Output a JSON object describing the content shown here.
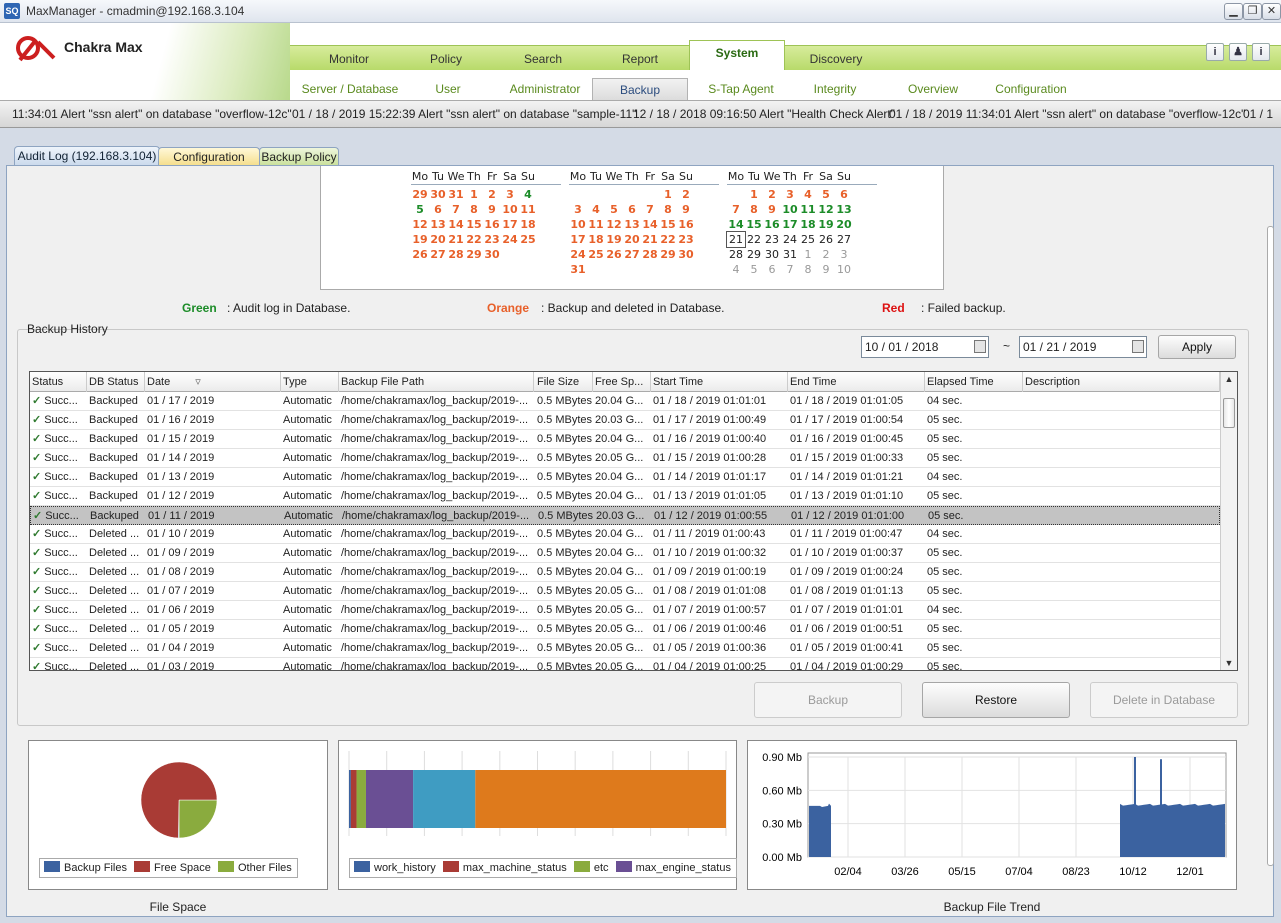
{
  "window": {
    "title": "MaxManager - cmadmin@192.168.3.104"
  },
  "app": {
    "logo_text": "Chakra Max"
  },
  "main_nav": {
    "tabs": [
      "Monitor",
      "Policy",
      "Search",
      "Report",
      "System",
      "Discovery"
    ],
    "active": "System"
  },
  "sub_nav": {
    "tabs": [
      "Server / Database",
      "User",
      "Administrator",
      "Backup",
      "S-Tap Agent",
      "Integrity",
      "Overview",
      "Configuration"
    ],
    "active": "Backup"
  },
  "ticker": [
    "11:34:01 Alert \"ssn alert\" on database \"overflow-12c\"",
    "01 / 18 / 2019 15:22:39 Alert \"ssn alert\" on database \"sample-11\"",
    "12 / 18 / 2018 09:16:50 Alert \"Health Check Alert\"",
    "01 / 18 / 2019 11:34:01 Alert \"ssn alert\" on database \"overflow-12c\"",
    "01 / 1"
  ],
  "content_tabs": [
    "Audit Log (192.168.3.104)",
    "Configuration Data",
    "Backup Policy"
  ],
  "calendar": {
    "weekdays": [
      "Mo",
      "Tu",
      "We",
      "Th",
      "Fr",
      "Sa",
      "Su"
    ]
  },
  "legend": {
    "green_label": "Green",
    "green_text": ": Audit log in Database.",
    "orange_label": "Orange",
    "orange_text": ": Backup and deleted in Database.",
    "red_label": "Red",
    "red_text": ": Failed backup.",
    "green_color": "#1c8c28",
    "orange_color": "#e8602a",
    "red_color": "#d11"
  },
  "backup_history": {
    "title": "Backup History",
    "date_from": "10 / 01 / 2018",
    "date_to": "01 / 21 / 2019",
    "date_sep": "~",
    "apply_label": "Apply",
    "columns": [
      "Status",
      "DB Status",
      "Date",
      "Type",
      "Backup File Path",
      "File Size",
      "Free Sp...",
      "Start Time",
      "End Time",
      "Elapsed Time",
      "Description"
    ],
    "sort_indicator": "▿",
    "rows": [
      {
        "status": "Succ...",
        "db": "Backuped",
        "date": "01 / 17 / 2019",
        "type": "Automatic",
        "path": "/home/chakramax/log_backup/2019-...",
        "size": "0.5 MBytes",
        "free": "20.04 G...",
        "start": "01 / 18 / 2019 01:01:01",
        "end": "01 / 18 / 2019 01:01:05",
        "elapsed": "04 sec."
      },
      {
        "status": "Succ...",
        "db": "Backuped",
        "date": "01 / 16 / 2019",
        "type": "Automatic",
        "path": "/home/chakramax/log_backup/2019-...",
        "size": "0.5 MBytes",
        "free": "20.03 G...",
        "start": "01 / 17 / 2019 01:00:49",
        "end": "01 / 17 / 2019 01:00:54",
        "elapsed": "05 sec."
      },
      {
        "status": "Succ...",
        "db": "Backuped",
        "date": "01 / 15 / 2019",
        "type": "Automatic",
        "path": "/home/chakramax/log_backup/2019-...",
        "size": "0.5 MBytes",
        "free": "20.04 G...",
        "start": "01 / 16 / 2019 01:00:40",
        "end": "01 / 16 / 2019 01:00:45",
        "elapsed": "05 sec."
      },
      {
        "status": "Succ...",
        "db": "Backuped",
        "date": "01 / 14 / 2019",
        "type": "Automatic",
        "path": "/home/chakramax/log_backup/2019-...",
        "size": "0.5 MBytes",
        "free": "20.05 G...",
        "start": "01 / 15 / 2019 01:00:28",
        "end": "01 / 15 / 2019 01:00:33",
        "elapsed": "05 sec."
      },
      {
        "status": "Succ...",
        "db": "Backuped",
        "date": "01 / 13 / 2019",
        "type": "Automatic",
        "path": "/home/chakramax/log_backup/2019-...",
        "size": "0.5 MBytes",
        "free": "20.04 G...",
        "start": "01 / 14 / 2019 01:01:17",
        "end": "01 / 14 / 2019 01:01:21",
        "elapsed": "04 sec."
      },
      {
        "status": "Succ...",
        "db": "Backuped",
        "date": "01 / 12 / 2019",
        "type": "Automatic",
        "path": "/home/chakramax/log_backup/2019-...",
        "size": "0.5 MBytes",
        "free": "20.04 G...",
        "start": "01 / 13 / 2019 01:01:05",
        "end": "01 / 13 / 2019 01:01:10",
        "elapsed": "05 sec."
      },
      {
        "status": "Succ...",
        "db": "Backuped",
        "date": "01 / 11 / 2019",
        "type": "Automatic",
        "path": "/home/chakramax/log_backup/2019-...",
        "size": "0.5 MBytes",
        "free": "20.03 G...",
        "start": "01 / 12 / 2019 01:00:55",
        "end": "01 / 12 / 2019 01:01:00",
        "elapsed": "05 sec.",
        "selected": true
      },
      {
        "status": "Succ...",
        "db": "Deleted ...",
        "date": "01 / 10 / 2019",
        "type": "Automatic",
        "path": "/home/chakramax/log_backup/2019-...",
        "size": "0.5 MBytes",
        "free": "20.04 G...",
        "start": "01 / 11 / 2019 01:00:43",
        "end": "01 / 11 / 2019 01:00:47",
        "elapsed": "04 sec."
      },
      {
        "status": "Succ...",
        "db": "Deleted ...",
        "date": "01 / 09 / 2019",
        "type": "Automatic",
        "path": "/home/chakramax/log_backup/2019-...",
        "size": "0.5 MBytes",
        "free": "20.04 G...",
        "start": "01 / 10 / 2019 01:00:32",
        "end": "01 / 10 / 2019 01:00:37",
        "elapsed": "05 sec."
      },
      {
        "status": "Succ...",
        "db": "Deleted ...",
        "date": "01 / 08 / 2019",
        "type": "Automatic",
        "path": "/home/chakramax/log_backup/2019-...",
        "size": "0.5 MBytes",
        "free": "20.04 G...",
        "start": "01 / 09 / 2019 01:00:19",
        "end": "01 / 09 / 2019 01:00:24",
        "elapsed": "05 sec."
      },
      {
        "status": "Succ...",
        "db": "Deleted ...",
        "date": "01 / 07 / 2019",
        "type": "Automatic",
        "path": "/home/chakramax/log_backup/2019-...",
        "size": "0.5 MBytes",
        "free": "20.05 G...",
        "start": "01 / 08 / 2019 01:01:08",
        "end": "01 / 08 / 2019 01:01:13",
        "elapsed": "05 sec."
      },
      {
        "status": "Succ...",
        "db": "Deleted ...",
        "date": "01 / 06 / 2019",
        "type": "Automatic",
        "path": "/home/chakramax/log_backup/2019-...",
        "size": "0.5 MBytes",
        "free": "20.05 G...",
        "start": "01 / 07 / 2019 01:00:57",
        "end": "01 / 07 / 2019 01:01:01",
        "elapsed": "04 sec."
      },
      {
        "status": "Succ...",
        "db": "Deleted ...",
        "date": "01 / 05 / 2019",
        "type": "Automatic",
        "path": "/home/chakramax/log_backup/2019-...",
        "size": "0.5 MBytes",
        "free": "20.05 G...",
        "start": "01 / 06 / 2019 01:00:46",
        "end": "01 / 06 / 2019 01:00:51",
        "elapsed": "05 sec."
      },
      {
        "status": "Succ...",
        "db": "Deleted ...",
        "date": "01 / 04 / 2019",
        "type": "Automatic",
        "path": "/home/chakramax/log_backup/2019-...",
        "size": "0.5 MBytes",
        "free": "20.05 G...",
        "start": "01 / 05 / 2019 01:00:36",
        "end": "01 / 05 / 2019 01:00:41",
        "elapsed": "05 sec."
      },
      {
        "status": "Succ...",
        "db": "Deleted ...",
        "date": "01 / 03 / 2019",
        "type": "Automatic",
        "path": "/home/chakramax/log_backup/2019-...",
        "size": "0.5 MBytes",
        "free": "20.05 G...",
        "start": "01 / 04 / 2019 01:00:25",
        "end": "01 / 04 / 2019 01:00:29",
        "elapsed": "05 sec."
      }
    ]
  },
  "actions": {
    "backup": "Backup",
    "restore": "Restore",
    "delete": "Delete in Database"
  },
  "file_space": {
    "caption": "File Space",
    "legend": [
      "Backup Files",
      "Free Space",
      "Other Files"
    ],
    "colors": {
      "backup": "#3b62a0",
      "free": "#a93b35",
      "other": "#8aab3e"
    }
  },
  "usage_bar": {
    "legend": [
      "work_history",
      "max_machine_status",
      "etc",
      "max_engine_status"
    ],
    "colors": [
      "#3b62a0",
      "#a93b35",
      "#8aab3e",
      "#6a4f94",
      "#3f9cc2",
      "#de7a1c"
    ]
  },
  "backup_trend": {
    "caption": "Backup File Trend",
    "y_ticks": [
      "0.90 Mb",
      "0.60 Mb",
      "0.30 Mb",
      "0.00 Mb"
    ],
    "x_ticks": [
      "02/04",
      "03/26",
      "05/15",
      "07/04",
      "08/23",
      "10/12",
      "12/01"
    ],
    "color": "#3b62a0"
  },
  "chart_data": [
    {
      "type": "pie",
      "title": "File Space",
      "labels": [
        "Backup Files",
        "Free Space",
        "Other Files"
      ],
      "values": [
        0.3,
        74.7,
        25.0
      ]
    },
    {
      "type": "bar",
      "title": "",
      "stacked_horizontal": true,
      "series": [
        {
          "name": "work_history",
          "value": 0.5
        },
        {
          "name": "max_machine_status",
          "value": 1.5
        },
        {
          "name": "etc",
          "value": 2.5
        },
        {
          "name": "max_engine_status",
          "value": 12.5
        },
        {
          "name": "",
          "value": 16.5
        },
        {
          "name": "",
          "value": 66.5
        }
      ]
    },
    {
      "type": "area",
      "title": "Backup File Trend",
      "ylabel": "",
      "ylim": [
        0,
        0.9
      ],
      "y_unit": "Mb",
      "x_ticks": [
        "02/04",
        "03/26",
        "05/15",
        "07/04",
        "08/23",
        "10/12",
        "12/01"
      ],
      "segments": [
        {
          "from": "01/17",
          "to": "01/29",
          "value": 0.46,
          "peak": 0.48
        },
        {
          "from": "10/08",
          "to": "01/20",
          "value": 0.47,
          "peaks": [
            0.9,
            0.88
          ]
        }
      ]
    }
  ]
}
